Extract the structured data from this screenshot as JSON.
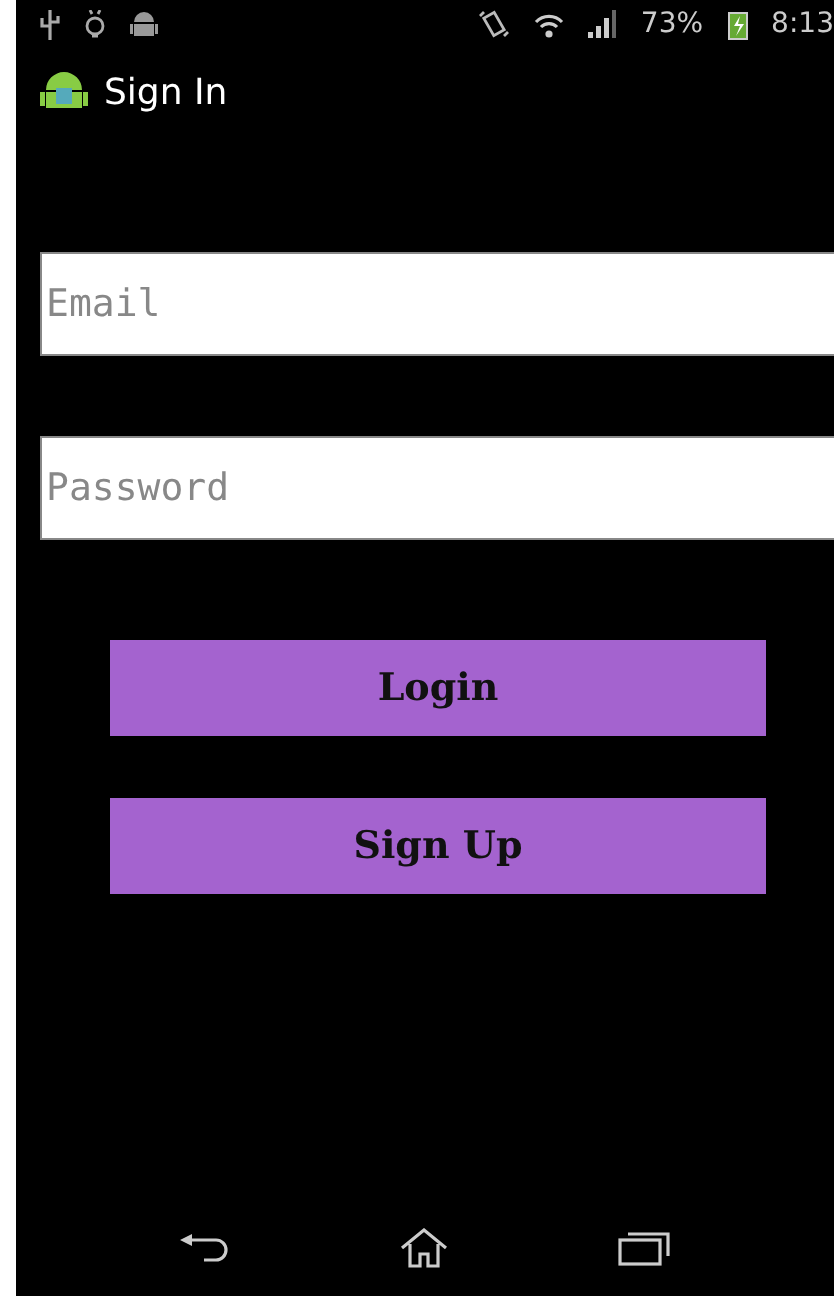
{
  "status_bar": {
    "battery_percent": "73%",
    "time": "8:13"
  },
  "action_bar": {
    "title": "Sign In"
  },
  "fields": [
    {
      "placeholder": "Email"
    },
    {
      "placeholder": "Password"
    }
  ],
  "buttons": [
    "Login",
    "Sign Up"
  ]
}
